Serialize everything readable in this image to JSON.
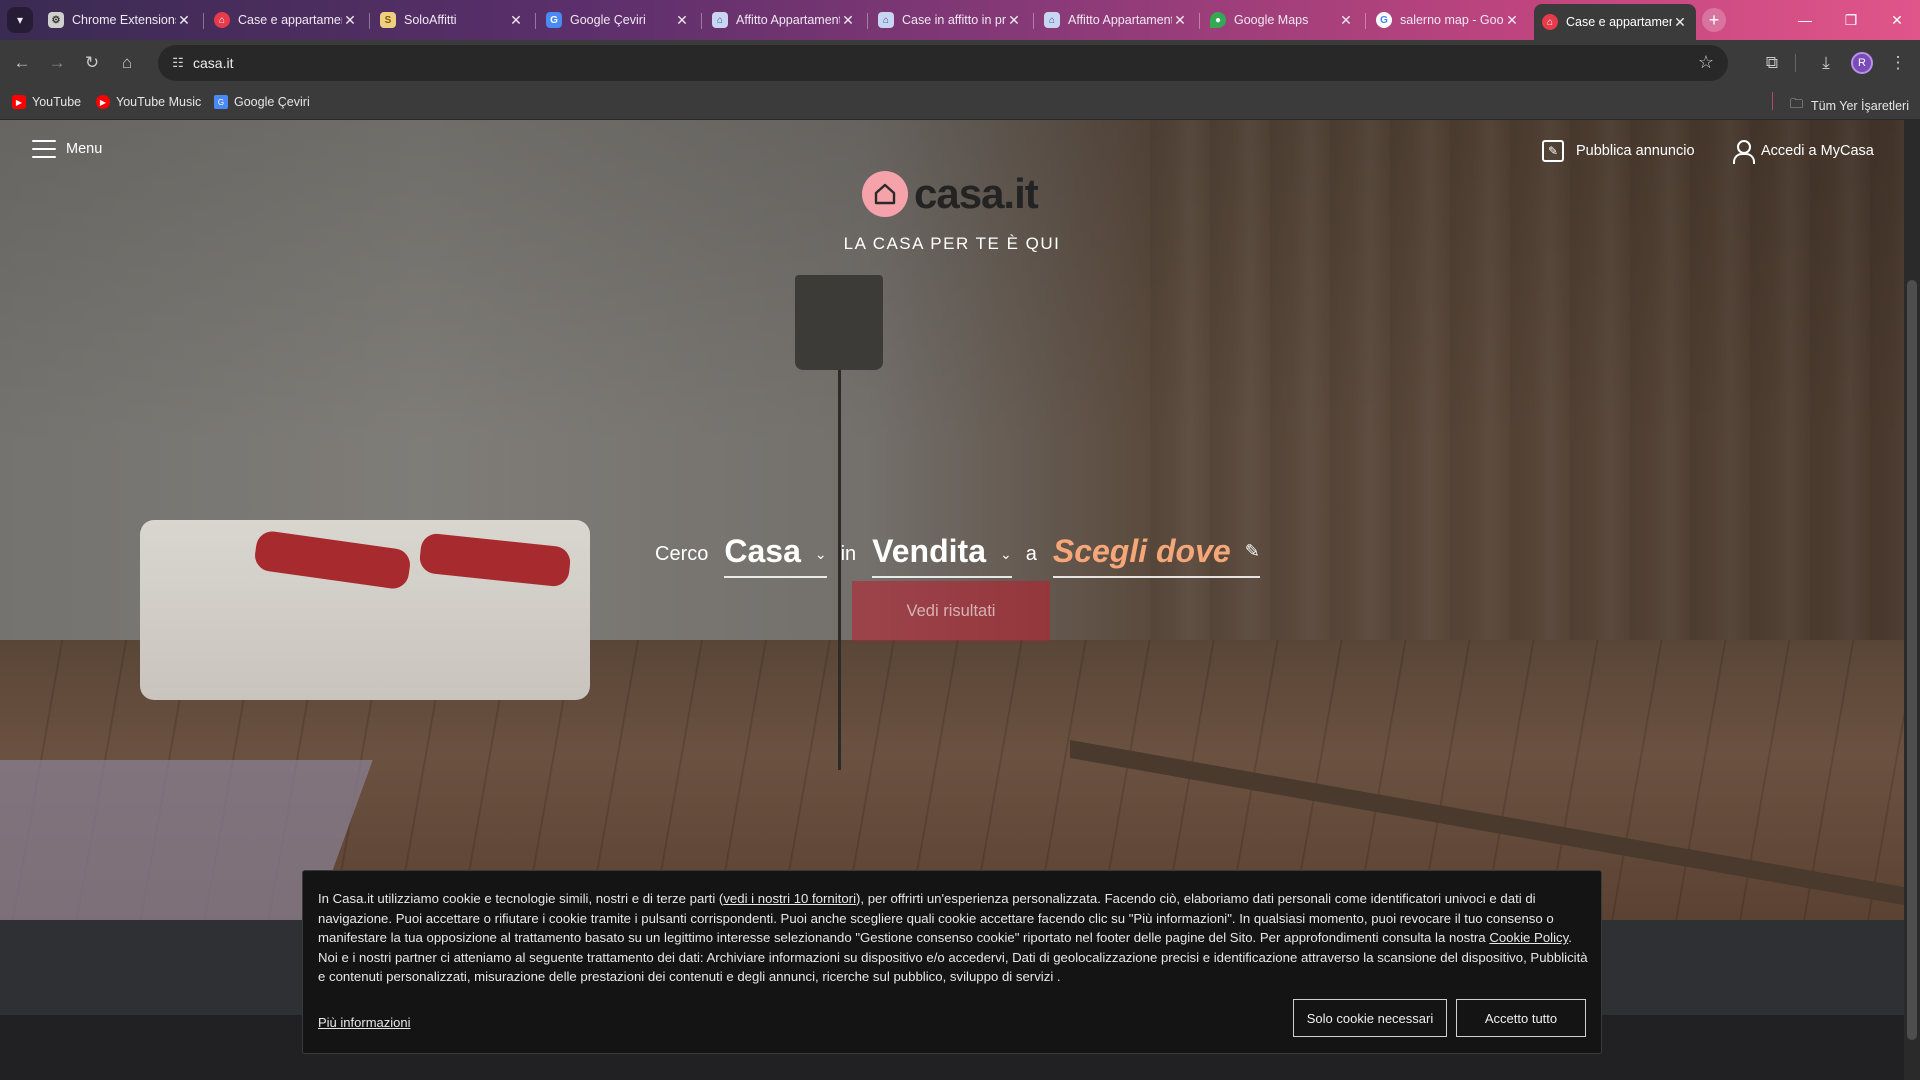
{
  "browser": {
    "tabs": [
      {
        "title": "Chrome Extensions",
        "favicon": "gear-icon",
        "color": "#cfcfcf"
      },
      {
        "title": "Case e appartamenti",
        "favicon": "casa-icon",
        "color": "#e63b4b"
      },
      {
        "title": "SoloAffitti",
        "favicon": "soloaffitti-icon",
        "color": "#f0d080"
      },
      {
        "title": "Google Çeviri",
        "favicon": "translate-icon",
        "color": "#4a8af4"
      },
      {
        "title": "Affitto Appartamenti",
        "favicon": "immobiliare-icon",
        "color": "#c9d6f2"
      },
      {
        "title": "Case in affitto in provincia",
        "favicon": "immobiliare-icon",
        "color": "#c9d6f2"
      },
      {
        "title": "Affitto Appartamenti",
        "favicon": "immobiliare-icon",
        "color": "#c9d6f2"
      },
      {
        "title": "Google Maps",
        "favicon": "maps-icon",
        "color": "#34a853"
      },
      {
        "title": "salerno map - Google",
        "favicon": "google-icon",
        "color": "#ffffff"
      },
      {
        "title": "Case e appartamenti",
        "favicon": "casa-icon",
        "color": "#e63b4b",
        "active": true
      }
    ],
    "url": "casa.it",
    "profile_initial": "R",
    "bookmarks": [
      {
        "label": "YouTube",
        "icon": "youtube-icon",
        "color": "#ff0000"
      },
      {
        "label": "YouTube Music",
        "icon": "youtube-music-icon",
        "color": "#ff0000"
      },
      {
        "label": "Google Çeviri",
        "icon": "translate-icon",
        "color": "#4a8af4"
      }
    ],
    "all_bookmarks_label": "Tüm Yer İşaretleri"
  },
  "site": {
    "menu_label": "Menu",
    "publish_label": "Pubblica annuncio",
    "login_label": "Accedi a MyCasa",
    "logo_text": "casa.it",
    "tagline": "LA CASA PER TE È QUI",
    "search": {
      "w_cerco": "Cerco",
      "type_value": "Casa",
      "w_in": "in",
      "contract_value": "Vendita",
      "w_a": "a",
      "where_placeholder": "Scegli dove",
      "cta_label": "Vedi risultati"
    }
  },
  "cookie": {
    "t1": "In Casa.it utilizziamo cookie e tecnologie simili, nostri e di terze parti (",
    "link_vendors": "vedi i nostri 10 fornitori",
    "t2": "), per offrirti un'esperienza personalizzata. Facendo ciò, elaboriamo dati personali come identificatori univoci e dati di navigazione. Puoi accettare o rifiutare i cookie tramite i pulsanti corrispondenti. Puoi anche scegliere quali cookie accettare facendo clic su \"Più informazioni\". In qualsiasi momento, puoi revocare il tuo consenso o manifestare la tua opposizione al trattamento basato su un legittimo interesse selezionando \"Gestione consenso cookie\" riportato nel footer delle pagine del Sito. Per approfondimenti consulta la nostra ",
    "link_policy": "Cookie Policy",
    "t3": ". Noi e i nostri partner ci atteniamo al seguente trattamento dei dati: Archiviare informazioni su dispositivo e/o accedervi, Dati di geolocalizzazione precisi e identificazione attraverso la scansione del dispositivo, Pubblicità e contenuti personalizzati, misurazione delle prestazioni dei contenuti e degli annunci, ricerche sul pubblico, sviluppo di servizi .",
    "more_label": "Più informazioni",
    "necessary_label": "Solo cookie necessari",
    "accept_label": "Accetto tutto"
  }
}
